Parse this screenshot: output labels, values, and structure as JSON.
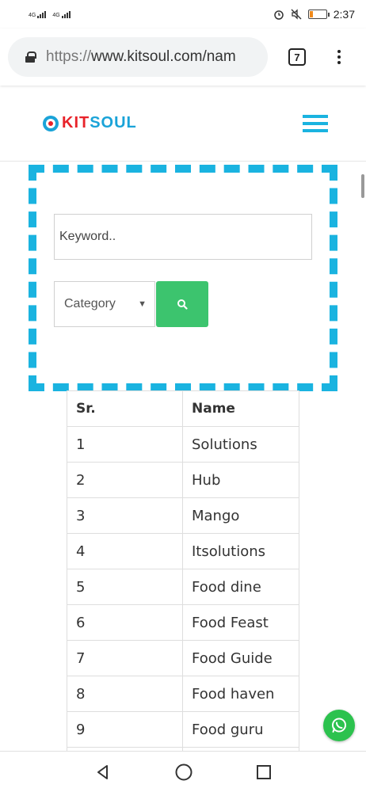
{
  "status_bar": {
    "network_1": "4G",
    "network_2": "4G",
    "time": "2:37",
    "battery_level": 0.2
  },
  "browser": {
    "url_scheme": "https://",
    "url_host": "www.kitsoul.com/nam",
    "tab_count": "7"
  },
  "site": {
    "logo_kit": "KIT",
    "logo_soul": "SOUL",
    "colors": {
      "brand_blue": "#1ab3e0",
      "brand_red": "#e8232a",
      "search_green": "#3cc46e"
    }
  },
  "search": {
    "keyword_placeholder": "Keyword..",
    "keyword_value": "",
    "category_selected": "Category"
  },
  "table": {
    "headers": [
      "Sr.",
      "Name"
    ],
    "rows": [
      [
        "1",
        "Solutions"
      ],
      [
        "2",
        "Hub"
      ],
      [
        "3",
        "Mango"
      ],
      [
        "4",
        "Itsolutions"
      ],
      [
        "5",
        "Food dine"
      ],
      [
        "6",
        "Food Feast"
      ],
      [
        "7",
        "Food Guide"
      ],
      [
        "8",
        "Food haven"
      ],
      [
        "9",
        "Food guru"
      ]
    ]
  },
  "icons": [
    "lock-icon",
    "tabs-icon",
    "more-vert-icon",
    "hamburger-menu-icon",
    "search-icon",
    "whatsapp-icon",
    "back-icon",
    "home-icon",
    "recents-icon"
  ]
}
